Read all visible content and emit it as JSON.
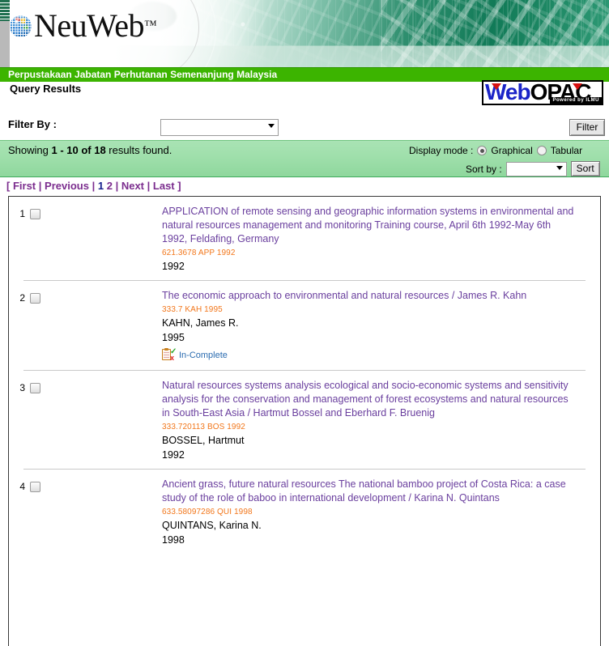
{
  "banner": {
    "logo_text": "NeuWeb",
    "logo_tm": "™",
    "library_name": "Perpustakaan Jabatan Perhutanan Semenanjung Malaysia"
  },
  "opac": {
    "web": "Web",
    "opac": "OPAC",
    "powered": "Powered by ILMU"
  },
  "page": {
    "title": "Query Results"
  },
  "filter": {
    "label": "Filter By :",
    "selected": "",
    "button": "Filter"
  },
  "results_bar": {
    "showing_prefix": "Showing ",
    "range": "1 - 10 of 18",
    "showing_suffix": " results found.",
    "display_mode_label": "Display mode :",
    "mode_graphical": "Graphical",
    "mode_tabular": "Tabular",
    "mode_selected": "Graphical",
    "sort_label": "Sort by :",
    "sort_selected": "",
    "sort_button": "Sort"
  },
  "pager": {
    "open": "[",
    "first": "First",
    "previous": "Previous",
    "pages": [
      "1",
      "2"
    ],
    "current_page": "1",
    "next": "Next",
    "last": "Last",
    "close": "]",
    "sep": "|"
  },
  "records": [
    {
      "number": "1",
      "title": "APPLICATION of remote sensing and geographic information systems in environmental and natural resources management and monitoring Training course, April 6th 1992-May 6th 1992, Feldafing, Germany",
      "call_number": "621.3678 APP 1992",
      "author": "",
      "year": "1992",
      "status": ""
    },
    {
      "number": "2",
      "title": "The economic approach to environmental and natural resources / James R. Kahn",
      "call_number": "333.7 KAH 1995",
      "author": "KAHN, James R.",
      "year": "1995",
      "status": "In-Complete"
    },
    {
      "number": "3",
      "title": "Natural resources systems analysis ecological and socio-economic systems and sensitivity analysis for the conservation and management of forest ecosystems and natural resources in South-East Asia / Hartmut Bossel and Eberhard F. Bruenig",
      "call_number": "333.720113 BOS 1992",
      "author": "BOSSEL, Hartmut",
      "year": "1992",
      "status": ""
    },
    {
      "number": "4",
      "title": "Ancient grass, future natural resources The national bamboo project of Costa Rica: a case study of the role of baboo in international development / Karina N. Quintans",
      "call_number": "633.58097286 QUI 1998",
      "author": "QUINTANS, Karina N.",
      "year": "1998",
      "status": ""
    }
  ],
  "colors": {
    "brand_green": "#3cb400",
    "title_purple": "#6a3f9e",
    "call_orange": "#f2761a",
    "link_purple": "#7b2d8e",
    "current_page_blue": "#141e8c",
    "status_blue": "#2b6cb0"
  }
}
